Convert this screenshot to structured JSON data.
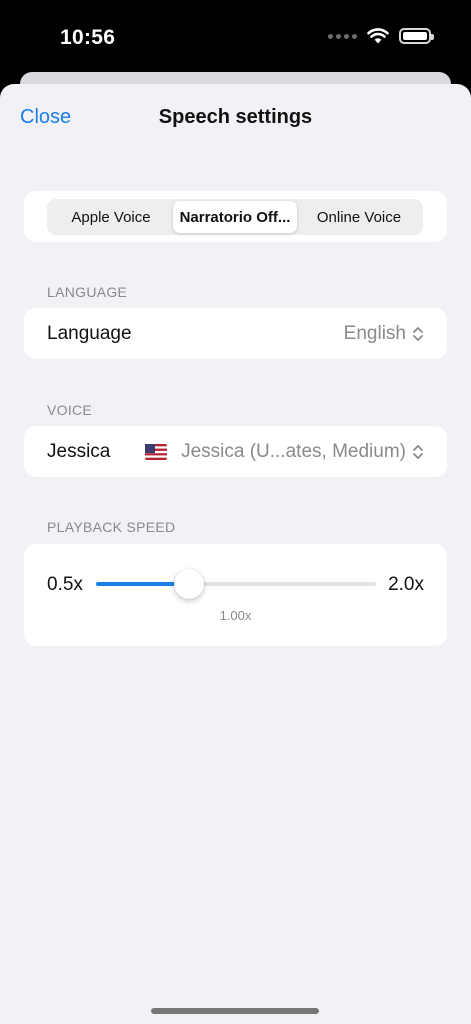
{
  "status_bar": {
    "time": "10:56"
  },
  "nav": {
    "close_label": "Close",
    "title": "Speech settings"
  },
  "segments": [
    {
      "label": "Apple Voice",
      "active": false
    },
    {
      "label": "Narratorio Off...",
      "active": true
    },
    {
      "label": "Online Voice",
      "active": false
    }
  ],
  "language": {
    "header": "LANGUAGE",
    "label": "Language",
    "value": "English"
  },
  "voice": {
    "header": "VOICE",
    "label": "Jessica",
    "value": "Jessica (U...ates, Medium)",
    "flag_icon": "us-flag-icon"
  },
  "playback_speed": {
    "header": "PLAYBACK SPEED",
    "min_label": "0.5x",
    "max_label": "2.0x",
    "value_label": "1.00x",
    "min": 0.5,
    "max": 2.0,
    "value": 1.0
  },
  "colors": {
    "accent": "#1a7fe6",
    "background": "#f2f1f6",
    "card": "#ffffff",
    "secondary_text": "#8a8a8e"
  }
}
